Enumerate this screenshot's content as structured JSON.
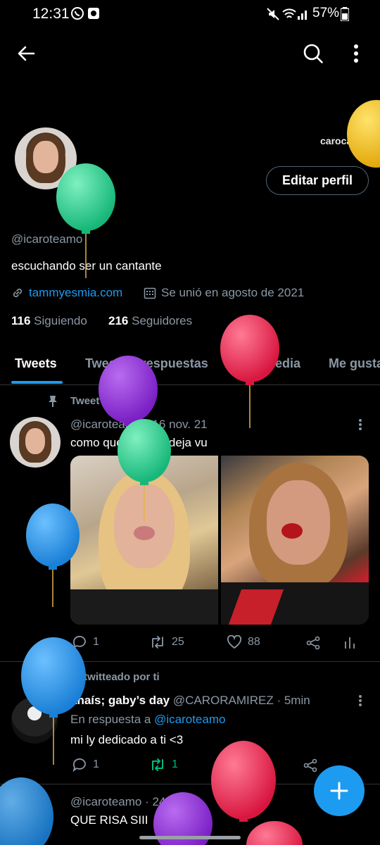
{
  "status_bar": {
    "time": "12:31",
    "battery": "57%"
  },
  "profile": {
    "floating_label": "carocali",
    "edit_button": "Editar perfil",
    "handle": "@icaroteamo",
    "bio": "escuchando ser un cantante",
    "website": "tammyesmia.com",
    "joined": "Se unió en agosto de 2021",
    "following_count": "116",
    "following_label": "Siguiendo",
    "followers_count": "216",
    "followers_label": "Seguidores"
  },
  "tabs": [
    "Tweets",
    "Tweets y respuestas",
    "Multimedia",
    "Me gusta"
  ],
  "pinned_tweet": {
    "pinned_label": "Tweet fijado",
    "handle": "@icaroteamo",
    "date": "· 16 nov. 21",
    "text": "como que tuve un deja vu",
    "replies": "1",
    "retweets": "25",
    "likes": "88"
  },
  "retweet": {
    "retweet_label": "Retwitteado por ti",
    "name": "anaís; gaby’s day",
    "handle": "@CARORAMIREZ",
    "time": "· 5min",
    "reply_prefix": "En respuesta a",
    "reply_to": "@icaroteamo",
    "text": "mi ly dedicado a ti <3",
    "replies": "1",
    "retweets": "1"
  },
  "third_tweet": {
    "handle": "@icaroteamo",
    "time": "· 24s",
    "text": "QUE RISA SIII"
  },
  "colors": {
    "accent": "#1d9bf0",
    "retweet_green": "#00ba7c",
    "background": "#000000"
  }
}
